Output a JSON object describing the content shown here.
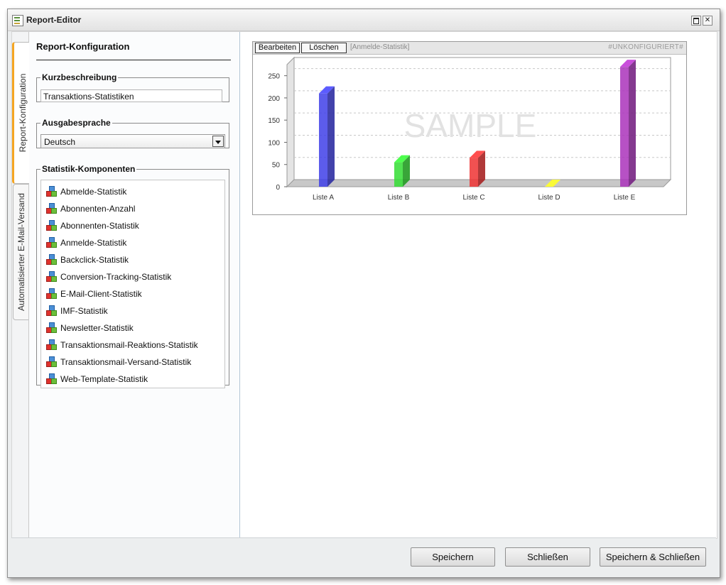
{
  "window": {
    "title": "Report-Editor"
  },
  "tabs": [
    {
      "label": "Report-Konfiguration",
      "active": true
    },
    {
      "label": "Automatisierter E-Mail-Versand",
      "active": false
    }
  ],
  "config": {
    "title": "Report-Konfiguration",
    "short_desc": {
      "legend": "Kurzbeschreibung",
      "value": "Transaktions-Statistiken"
    },
    "language": {
      "legend": "Ausgabesprache",
      "value": "Deutsch"
    },
    "components": {
      "legend": "Statistik-Komponenten",
      "items": [
        "Abmelde-Statistik",
        "Abonnenten-Anzahl",
        "Abonnenten-Statistik",
        "Anmelde-Statistik",
        "Backclick-Statistik",
        "Conversion-Tracking-Statistik",
        "E-Mail-Client-Statistik",
        "IMF-Statistik",
        "Newsletter-Statistik",
        "Transaktionsmail-Reaktions-Statistik",
        "Transaktionsmail-Versand-Statistik",
        "Web-Template-Statistik"
      ]
    }
  },
  "widget": {
    "edit_label": "Bearbeiten",
    "delete_label": "Löschen",
    "name": "[Anmelde-Statistik]",
    "status": "#UNKONFIGURIERT#",
    "watermark": "SAMPLE"
  },
  "chart_data": {
    "type": "bar",
    "categories": [
      "Liste A",
      "Liste B",
      "Liste C",
      "Liste D",
      "Liste E"
    ],
    "values": [
      210,
      55,
      65,
      0,
      270
    ],
    "colors": [
      "#4040e8",
      "#33dd33",
      "#ee3333",
      "#eeee22",
      "#aa33bb"
    ],
    "ylim": [
      0,
      275
    ],
    "yticks": [
      0,
      50,
      100,
      150,
      200,
      250
    ],
    "grid": true,
    "style": "3d-bar"
  },
  "buttons": {
    "save": "Speichern",
    "close": "Schließen",
    "save_close": "Speichern & Schließen"
  }
}
